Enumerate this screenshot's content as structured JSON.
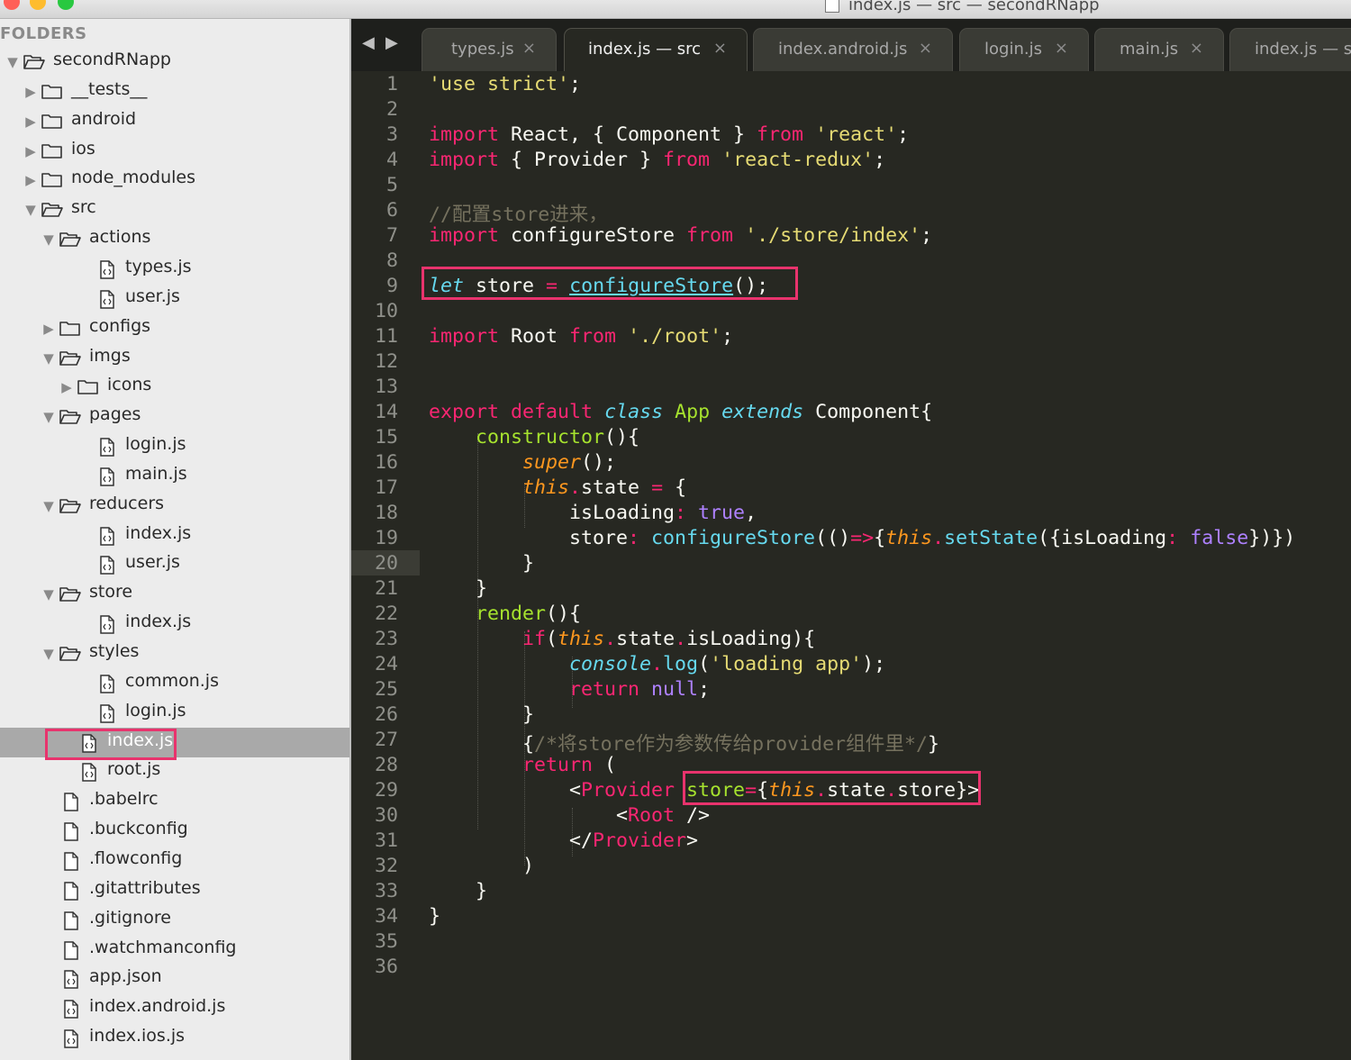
{
  "window": {
    "title": "index.js — src — secondRNapp"
  },
  "sidebar": {
    "title": "FOLDERS",
    "tree": [
      {
        "label": "secondRNapp",
        "type": "folder",
        "depth": 0,
        "open": true
      },
      {
        "label": "__tests__",
        "type": "folder",
        "depth": 1,
        "open": false
      },
      {
        "label": "android",
        "type": "folder",
        "depth": 1,
        "open": false
      },
      {
        "label": "ios",
        "type": "folder",
        "depth": 1,
        "open": false
      },
      {
        "label": "node_modules",
        "type": "folder",
        "depth": 1,
        "open": false
      },
      {
        "label": "src",
        "type": "folder",
        "depth": 1,
        "open": true
      },
      {
        "label": "actions",
        "type": "folder",
        "depth": 2,
        "open": true
      },
      {
        "label": "types.js",
        "type": "code",
        "depth": 3
      },
      {
        "label": "user.js",
        "type": "code",
        "depth": 3
      },
      {
        "label": "configs",
        "type": "folder",
        "depth": 2,
        "open": false
      },
      {
        "label": "imgs",
        "type": "folder",
        "depth": 2,
        "open": true
      },
      {
        "label": "icons",
        "type": "folder",
        "depth": 3,
        "open": false
      },
      {
        "label": "pages",
        "type": "folder",
        "depth": 2,
        "open": true
      },
      {
        "label": "login.js",
        "type": "code",
        "depth": 3
      },
      {
        "label": "main.js",
        "type": "code",
        "depth": 3
      },
      {
        "label": "reducers",
        "type": "folder",
        "depth": 2,
        "open": true
      },
      {
        "label": "index.js",
        "type": "code",
        "depth": 3
      },
      {
        "label": "user.js",
        "type": "code",
        "depth": 3
      },
      {
        "label": "store",
        "type": "folder",
        "depth": 2,
        "open": true
      },
      {
        "label": "index.js",
        "type": "code",
        "depth": 3
      },
      {
        "label": "styles",
        "type": "folder",
        "depth": 2,
        "open": true
      },
      {
        "label": "common.js",
        "type": "code",
        "depth": 3
      },
      {
        "label": "login.js",
        "type": "code",
        "depth": 3
      },
      {
        "label": "index.js",
        "type": "code",
        "depth": 2,
        "selected": true
      },
      {
        "label": "root.js",
        "type": "code",
        "depth": 2
      },
      {
        "label": ".babelrc",
        "type": "file",
        "depth": 1
      },
      {
        "label": ".buckconfig",
        "type": "file",
        "depth": 1
      },
      {
        "label": ".flowconfig",
        "type": "file",
        "depth": 1
      },
      {
        "label": ".gitattributes",
        "type": "file",
        "depth": 1
      },
      {
        "label": ".gitignore",
        "type": "file",
        "depth": 1
      },
      {
        "label": ".watchmanconfig",
        "type": "file",
        "depth": 1
      },
      {
        "label": "app.json",
        "type": "code",
        "depth": 1
      },
      {
        "label": "index.android.js",
        "type": "code",
        "depth": 1
      },
      {
        "label": "index.ios.js",
        "type": "code",
        "depth": 1
      }
    ]
  },
  "tabs": [
    {
      "label": "types.js",
      "close": "×",
      "active": false
    },
    {
      "label": "index.js — src",
      "close": "×",
      "active": true
    },
    {
      "label": "index.android.js",
      "close": "×",
      "active": false
    },
    {
      "label": "login.js",
      "close": "×",
      "active": false
    },
    {
      "label": "main.js",
      "close": "×",
      "active": false
    },
    {
      "label": "index.js — s",
      "close": "",
      "active": false
    }
  ],
  "editor": {
    "current_line": 20,
    "lines": [
      [
        [
          "s",
          "'use strict'"
        ],
        [
          "",
          "; "
        ]
      ],
      [],
      [
        [
          "k",
          "import"
        ],
        [
          "",
          " React, { Component } "
        ],
        [
          "k",
          "from"
        ],
        [
          "",
          " "
        ],
        [
          "s",
          "'react'"
        ],
        [
          "",
          ";"
        ]
      ],
      [
        [
          "k",
          "import"
        ],
        [
          "",
          " { Provider } "
        ],
        [
          "k",
          "from"
        ],
        [
          "",
          " "
        ],
        [
          "s",
          "'react-redux'"
        ],
        [
          "",
          ";"
        ]
      ],
      [],
      [
        [
          "c",
          "//配置store进来，"
        ]
      ],
      [
        [
          "k",
          "import"
        ],
        [
          "",
          " configureStore "
        ],
        [
          "k",
          "from"
        ],
        [
          "",
          " "
        ],
        [
          "s",
          "'./store/index'"
        ],
        [
          "",
          ";"
        ]
      ],
      [],
      [
        [
          "fi",
          "let"
        ],
        [
          "",
          " store "
        ],
        [
          "k",
          "="
        ],
        [
          "",
          " "
        ],
        [
          "f u",
          "configureStore"
        ],
        [
          "",
          "();"
        ]
      ],
      [],
      [
        [
          "k",
          "import"
        ],
        [
          "",
          " Root "
        ],
        [
          "k",
          "from"
        ],
        [
          "",
          " "
        ],
        [
          "s",
          "'./root'"
        ],
        [
          "",
          ";"
        ]
      ],
      [],
      [],
      [
        [
          "k",
          "export"
        ],
        [
          "",
          " "
        ],
        [
          "k",
          "default"
        ],
        [
          "",
          " "
        ],
        [
          "fi",
          "class"
        ],
        [
          "",
          " "
        ],
        [
          "g",
          "App"
        ],
        [
          "",
          " "
        ],
        [
          "fi",
          "extends"
        ],
        [
          "",
          " Component{"
        ]
      ],
      [
        [
          "",
          "    "
        ],
        [
          "g",
          "constructor"
        ],
        [
          "",
          "(){"
        ]
      ],
      [
        [
          "",
          "        "
        ],
        [
          "o",
          "super"
        ],
        [
          "",
          "();"
        ]
      ],
      [
        [
          "",
          "        "
        ],
        [
          "o",
          "this"
        ],
        [
          "k",
          "."
        ],
        [
          "",
          "state "
        ],
        [
          "k",
          "="
        ],
        [
          "",
          " {"
        ]
      ],
      [
        [
          "",
          "            isLoading"
        ],
        [
          "k",
          ":"
        ],
        [
          "",
          " "
        ],
        [
          "p",
          "true"
        ],
        [
          ","
        ]
      ],
      [
        [
          "",
          "            store"
        ],
        [
          "k",
          ":"
        ],
        [
          "",
          " "
        ],
        [
          "f",
          "configureStore"
        ],
        [
          "",
          "(()"
        ],
        [
          "k",
          "=>"
        ],
        [
          "",
          "{"
        ],
        [
          "o",
          "this"
        ],
        [
          "k",
          "."
        ],
        [
          "f",
          "setState"
        ],
        [
          "",
          "({isLoading"
        ],
        [
          "k",
          ":"
        ],
        [
          "",
          " "
        ],
        [
          "p",
          "false"
        ],
        [
          "",
          "})})"
        ]
      ],
      [
        [
          "",
          "        }"
        ]
      ],
      [
        [
          "",
          "    }"
        ]
      ],
      [
        [
          "",
          "    "
        ],
        [
          "g",
          "render"
        ],
        [
          "",
          "(){"
        ]
      ],
      [
        [
          "",
          "        "
        ],
        [
          "k",
          "if"
        ],
        [
          "",
          "("
        ],
        [
          "o",
          "this"
        ],
        [
          "k",
          "."
        ],
        [
          "",
          "state"
        ],
        [
          "k",
          "."
        ],
        [
          "",
          "isLoading){"
        ]
      ],
      [
        [
          "",
          "            "
        ],
        [
          "fi",
          "console"
        ],
        [
          "k",
          "."
        ],
        [
          "f",
          "log"
        ],
        [
          "",
          "("
        ],
        [
          "s",
          "'loading app'"
        ],
        [
          "",
          ");"
        ]
      ],
      [
        [
          "",
          "            "
        ],
        [
          "k",
          "return"
        ],
        [
          "",
          " "
        ],
        [
          "p",
          "null"
        ],
        [
          "",
          ";"
        ]
      ],
      [
        [
          "",
          "        }"
        ]
      ],
      [
        [
          "",
          "        {"
        ],
        [
          "c",
          "/*将store作为参数传给provider组件里*/"
        ],
        [
          "",
          "}"
        ]
      ],
      [
        [
          "",
          "        "
        ],
        [
          "k",
          "return"
        ],
        [
          "",
          " ("
        ]
      ],
      [
        [
          "",
          "            <"
        ],
        [
          "k",
          "Provider"
        ],
        [
          "",
          " "
        ],
        [
          "g",
          "store"
        ],
        [
          "k",
          "="
        ],
        [
          "",
          "{"
        ],
        [
          "o",
          "this"
        ],
        [
          "k",
          "."
        ],
        [
          "",
          "state"
        ],
        [
          "k",
          "."
        ],
        [
          "",
          "store}>"
        ]
      ],
      [
        [
          "",
          "                <"
        ],
        [
          "k",
          "Root"
        ],
        [
          "",
          " />"
        ]
      ],
      [
        [
          "",
          "            </"
        ],
        [
          "k",
          "Provider"
        ],
        [
          "",
          ">"
        ]
      ],
      [
        [
          "",
          "        )"
        ]
      ],
      [
        [
          "",
          "    }"
        ]
      ],
      [
        [
          "",
          "}"
        ]
      ],
      [],
      []
    ]
  },
  "colors": {
    "highlight": "#e8336d",
    "editor_bg": "#272822",
    "sidebar_bg": "#ececec",
    "keyword": "#f92672",
    "string": "#e6db74",
    "function": "#66d9ef"
  }
}
